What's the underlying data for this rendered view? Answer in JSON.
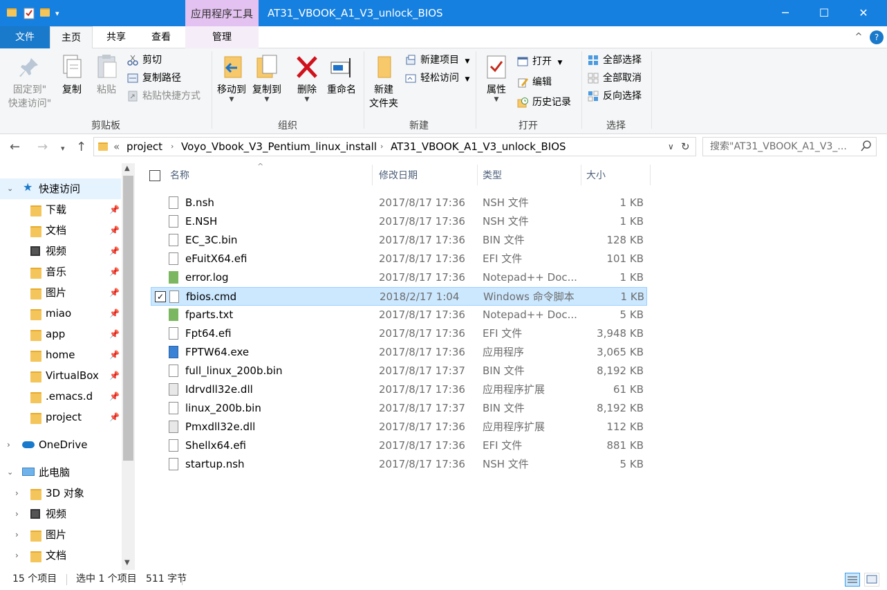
{
  "window": {
    "context_tab": "应用程序工具",
    "title": "AT31_VBOOK_A1_V3_unlock_BIOS",
    "buttons": {
      "minimize": "─",
      "maximize": "☐",
      "close": "✕"
    }
  },
  "tabs": {
    "file": "文件",
    "home": "主页",
    "share": "共享",
    "view": "查看",
    "manage": "管理",
    "collapse": "^",
    "help": "?"
  },
  "ribbon": {
    "clipboard": {
      "label": "剪贴板",
      "pin_line1": "固定到\"",
      "pin_line2": "快速访问\"",
      "copy": "复制",
      "paste": "粘贴",
      "cut": "剪切",
      "copy_path": "复制路径",
      "paste_shortcut": "粘贴快捷方式"
    },
    "organize": {
      "label": "组织",
      "move_to": "移动到",
      "copy_to": "复制到",
      "delete": "删除",
      "rename": "重命名"
    },
    "new": {
      "label": "新建",
      "new_folder_line1": "新建",
      "new_folder_line2": "文件夹",
      "new_item": "新建项目",
      "easy_access": "轻松访问"
    },
    "open": {
      "label": "打开",
      "properties": "属性",
      "open": "打开",
      "edit": "编辑",
      "history": "历史记录"
    },
    "select": {
      "label": "选择",
      "select_all": "全部选择",
      "select_none": "全部取消",
      "invert": "反向选择"
    }
  },
  "address": {
    "overflow": "«",
    "crumbs": [
      "project",
      "Voyo_Vbook_V3_Pentium_linux_install",
      "AT31_VBOOK_A1_V3_unlock_BIOS"
    ],
    "search_placeholder": "搜索\"AT31_VBOOK_A1_V3_..."
  },
  "nav": {
    "quick_access": "快速访问",
    "quick_items": [
      "下载",
      "文档",
      "视频",
      "音乐",
      "图片",
      "miao",
      "app",
      "home",
      "VirtualBox",
      ".emacs.d",
      "project"
    ],
    "onedrive": "OneDrive",
    "this_pc": "此电脑",
    "pc_items": [
      "3D 对象",
      "视频",
      "图片",
      "文档"
    ]
  },
  "columns": {
    "name": "名称",
    "date": "修改日期",
    "type": "类型",
    "size": "大小"
  },
  "files": [
    {
      "name": "B.nsh",
      "date": "2017/8/17 17:36",
      "type": "NSH 文件",
      "size": "1 KB",
      "icon": "doc"
    },
    {
      "name": "E.NSH",
      "date": "2017/8/17 17:36",
      "type": "NSH 文件",
      "size": "1 KB",
      "icon": "doc"
    },
    {
      "name": "EC_3C.bin",
      "date": "2017/8/17 17:36",
      "type": "BIN 文件",
      "size": "128 KB",
      "icon": "doc"
    },
    {
      "name": "eFuitX64.efi",
      "date": "2017/8/17 17:36",
      "type": "EFI 文件",
      "size": "101 KB",
      "icon": "doc"
    },
    {
      "name": "error.log",
      "date": "2017/8/17 17:36",
      "type": "Notepad++ Doc...",
      "size": "1 KB",
      "icon": "notepad"
    },
    {
      "name": "fbios.cmd",
      "date": "2018/2/17 1:04",
      "type": "Windows 命令脚本",
      "size": "1 KB",
      "icon": "cmd"
    },
    {
      "name": "fparts.txt",
      "date": "2017/8/17 17:36",
      "type": "Notepad++ Doc...",
      "size": "5 KB",
      "icon": "notepad"
    },
    {
      "name": "Fpt64.efi",
      "date": "2017/8/17 17:36",
      "type": "EFI 文件",
      "size": "3,948 KB",
      "icon": "doc"
    },
    {
      "name": "FPTW64.exe",
      "date": "2017/8/17 17:36",
      "type": "应用程序",
      "size": "3,065 KB",
      "icon": "exe"
    },
    {
      "name": "full_linux_200b.bin",
      "date": "2017/8/17 17:37",
      "type": "BIN 文件",
      "size": "8,192 KB",
      "icon": "doc"
    },
    {
      "name": "Idrvdll32e.dll",
      "date": "2017/8/17 17:36",
      "type": "应用程序扩展",
      "size": "61 KB",
      "icon": "dll"
    },
    {
      "name": "linux_200b.bin",
      "date": "2017/8/17 17:37",
      "type": "BIN 文件",
      "size": "8,192 KB",
      "icon": "doc"
    },
    {
      "name": "Pmxdll32e.dll",
      "date": "2017/8/17 17:36",
      "type": "应用程序扩展",
      "size": "112 KB",
      "icon": "dll"
    },
    {
      "name": "Shellx64.efi",
      "date": "2017/8/17 17:36",
      "type": "EFI 文件",
      "size": "881 KB",
      "icon": "doc"
    },
    {
      "name": "startup.nsh",
      "date": "2017/8/17 17:36",
      "type": "NSH 文件",
      "size": "5 KB",
      "icon": "doc"
    }
  ],
  "selected_file": "fbios.cmd",
  "status": {
    "count": "15 个项目",
    "selection": "选中 1 个项目",
    "size": "511 字节"
  },
  "colors": {
    "titlebar": "#1580e0",
    "accent": "#1979ca",
    "selection": "#cce8ff",
    "context_tab": "#e3c1f0"
  }
}
